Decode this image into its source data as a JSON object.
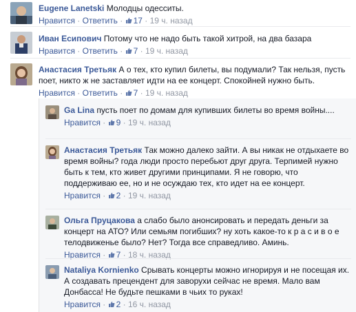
{
  "comments": [
    {
      "author": "Eugene Lanetski",
      "text": "Молодцы одесситы.",
      "like": "Нравится",
      "reply": "Ответить",
      "likes": "17",
      "time": "19 ч. назад"
    },
    {
      "author": "Иван Есипович",
      "text": "Потому что не надо быть такой хитрой, на два базара",
      "like": "Нравится",
      "reply": "Ответить",
      "likes": "7",
      "time": "19 ч. назад"
    },
    {
      "author": "Анастасия Третьяк",
      "text": "А о тех, кто купил билеты, вы подумали? Так нельзя, пусть поет, никто ж не заставляет идти на ее концерт. Спокойней нужно быть.",
      "like": "Нравится",
      "reply": "Ответить",
      "likes": "7",
      "time": "19 ч. назад"
    }
  ],
  "replies": [
    {
      "author": "Ga Lina",
      "text": "пусть поет по домам для купивших билеты во время войны....",
      "like": "Нравится",
      "likes": "9",
      "time": "19 ч. назад"
    },
    {
      "author": "Анастасия Третьяк",
      "text": "Так можно далеко зайти. А вы никак не отдыхаете во время войны? года люди просто перебьют друг друга. Терпимей нужно быть к тем, кто живет другими принципами. Я не говорю, что поддерживаю ее, но и не осуждаю тех, кто идет на ее концерт.",
      "like": "Нравится",
      "likes": "2",
      "time": "19 ч. назад"
    },
    {
      "author": "Ольга Пруцакова",
      "text": "а слабо было анонсировать и передать деньги за концерт на АТО? Или семьям погибших? ну хоть какое-то к р а с и в о е телодвиженье было? Нет? Тогда все справедливо. Аминь.",
      "like": "Нравится",
      "likes": "7",
      "time": "18 ч. назад"
    },
    {
      "author": "Nataliya Kornienko",
      "text": "Срывать концерты можно игнорируя и не посещая их. А создавать прецендент для заворухи сейчас не время. Мало вам Донбасса! Не будьте пешками в чьих то руках!",
      "like": "Нравится",
      "likes": "2",
      "time": "16 ч. назад"
    }
  ],
  "colors": {
    "link": "#3b5998",
    "meta": "#9197a3",
    "reply_bg": "#f6f7f9"
  }
}
